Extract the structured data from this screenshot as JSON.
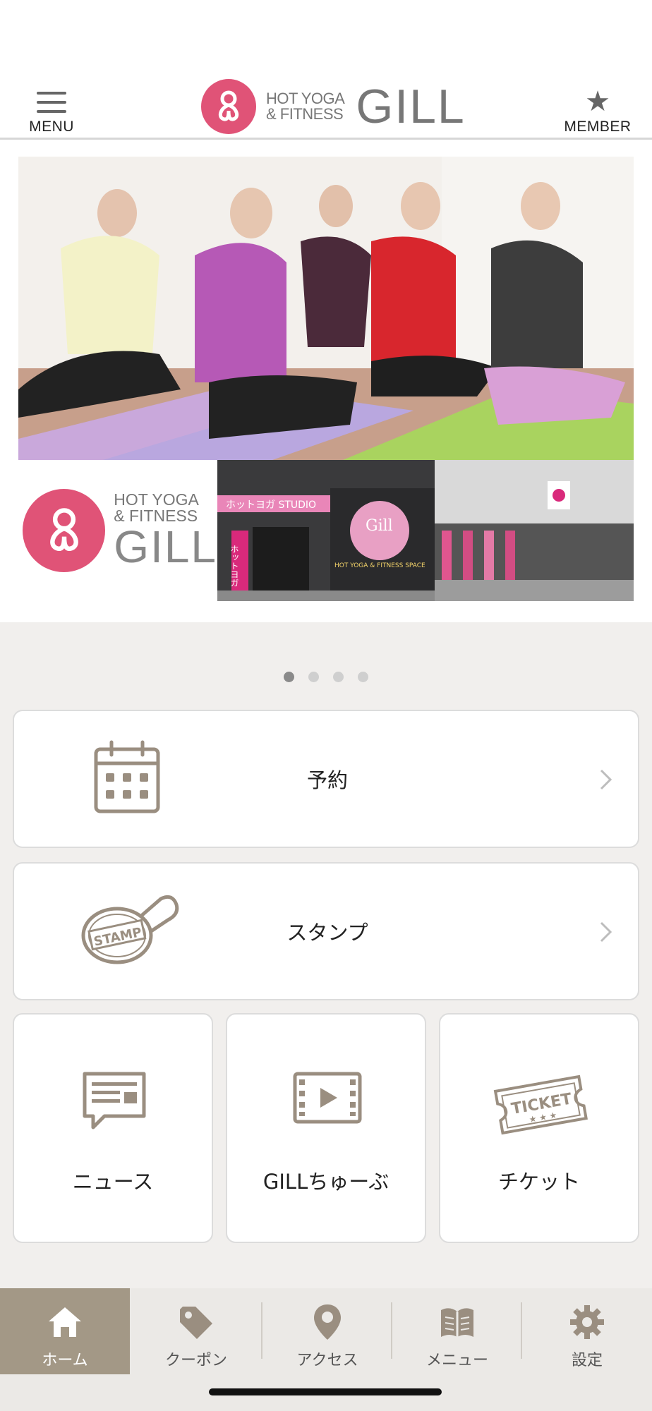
{
  "header": {
    "menu_label": "MENU",
    "member_label": "MEMBER",
    "logo_line1": "HOT YOGA",
    "logo_line2": "& FITNESS",
    "logo_brand": "GILL"
  },
  "banner": {
    "logo_line1": "HOT YOGA",
    "logo_line2": "& FITNESS",
    "logo_brand": "GILL",
    "store1_sign": "ホットヨガ STUDIO",
    "store1_logo": "Gill",
    "store1_sub": "HOT YOGA & FITNESS SPACE",
    "store_banner_text": "ホットヨガ"
  },
  "pager": {
    "count": 4,
    "active_index": 0
  },
  "cards": {
    "reserve": {
      "label": "予約",
      "icon": "calendar-icon"
    },
    "stamp": {
      "label": "スタンプ",
      "icon": "stamp-icon",
      "icon_text": "STAMP"
    },
    "news": {
      "label": "ニュース",
      "icon": "news-icon"
    },
    "tube": {
      "label": "GILLちゅーぶ",
      "icon": "video-icon"
    },
    "ticket": {
      "label": "チケット",
      "icon": "ticket-icon",
      "icon_text": "TICKET"
    }
  },
  "tabs": [
    {
      "label": "ホーム",
      "icon": "home-icon",
      "active": true
    },
    {
      "label": "クーポン",
      "icon": "tag-icon",
      "active": false
    },
    {
      "label": "アクセス",
      "icon": "map-pin-icon",
      "active": false
    },
    {
      "label": "メニュー",
      "icon": "book-icon",
      "active": false
    },
    {
      "label": "設定",
      "icon": "gear-icon",
      "active": false
    }
  ],
  "colors": {
    "brand_pink": "#e05377",
    "icon_taupe": "#9a8e80",
    "tab_active": "#a39886"
  }
}
